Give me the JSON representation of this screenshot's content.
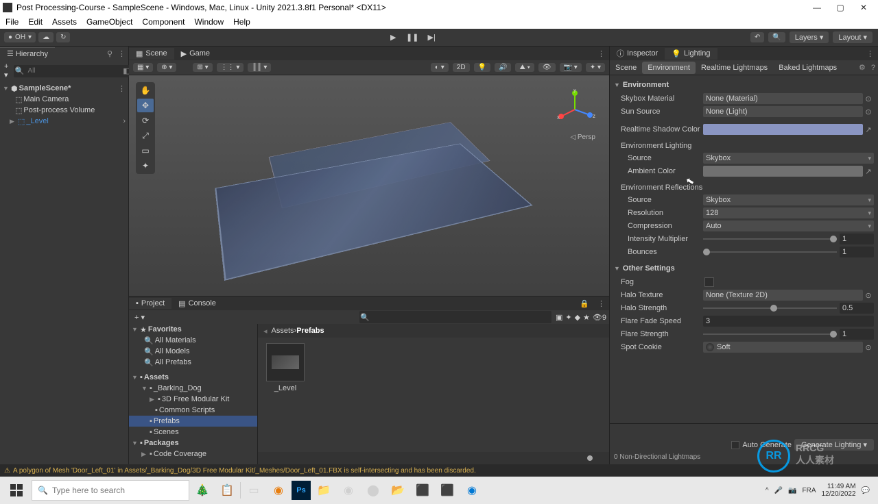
{
  "window": {
    "title": "Post Processing-Course - SampleScene - Windows, Mac, Linux - Unity 2021.3.8f1 Personal* <DX11>",
    "min": "—",
    "max": "▢",
    "close": "✕"
  },
  "menu": [
    "File",
    "Edit",
    "Assets",
    "GameObject",
    "Component",
    "Window",
    "Help"
  ],
  "toolbar": {
    "account": "OH",
    "layers": "Layers",
    "layout": "Layout",
    "play": "▶",
    "pause": "❚❚",
    "step": "▶|"
  },
  "hierarchy": {
    "tab": "Hierarchy",
    "searchPlaceholder": "All",
    "scene": "SampleScene*",
    "items": [
      "Main Camera",
      "Post-process Volume",
      "_Level"
    ]
  },
  "sceneTabs": {
    "scene": "Scene",
    "game": "Game"
  },
  "sceneToolbar": {
    "twoD": "2D",
    "persp": "Persp",
    "axes": {
      "x": "x",
      "y": "y",
      "z": "z"
    }
  },
  "project": {
    "tabs": {
      "project": "Project",
      "console": "Console"
    },
    "crumb": {
      "root": "Assets",
      "sep": "›",
      "leaf": "Prefabs"
    },
    "favorites": "Favorites",
    "favItems": [
      "All Materials",
      "All Models",
      "All Prefabs"
    ],
    "assets": "Assets",
    "folders": [
      "_Barking_Dog",
      "3D Free Modular Kit",
      "Common Scripts",
      "Prefabs",
      "Scenes"
    ],
    "packages": "Packages",
    "pkgItems": [
      "Code Coverage"
    ],
    "assetName": "_Level",
    "layerCount": "9"
  },
  "inspector": {
    "tabs": {
      "inspector": "Inspector",
      "lighting": "Lighting"
    },
    "subtabs": [
      "Scene",
      "Environment",
      "Realtime Lightmaps",
      "Baked Lightmaps"
    ],
    "activeSub": "Environment",
    "env": {
      "header": "Environment",
      "skyboxLabel": "Skybox Material",
      "skyboxVal": "None (Material)",
      "sunLabel": "Sun Source",
      "sunVal": "None (Light)",
      "shadowLabel": "Realtime Shadow Color",
      "shadowColor": "#8a95c2",
      "lightingHeader": "Environment Lighting",
      "sourceLabel": "Source",
      "sourceVal": "Skybox",
      "ambientLabel": "Ambient Color",
      "ambientColor": "#707070",
      "reflectHeader": "Environment Reflections",
      "refSourceLabel": "Source",
      "refSourceVal": "Skybox",
      "resLabel": "Resolution",
      "resVal": "128",
      "compLabel": "Compression",
      "compVal": "Auto",
      "intLabel": "Intensity Multiplier",
      "intVal": "1",
      "bouncesLabel": "Bounces",
      "bouncesVal": "1"
    },
    "other": {
      "header": "Other Settings",
      "fogLabel": "Fog",
      "haloTexLabel": "Halo Texture",
      "haloTexVal": "None (Texture 2D)",
      "haloStrLabel": "Halo Strength",
      "haloStrVal": "0.5",
      "flareFadeLabel": "Flare Fade Speed",
      "flareFadeVal": "3",
      "flareStrLabel": "Flare Strength",
      "flareStrVal": "1",
      "spotLabel": "Spot Cookie",
      "spotVal": "Soft"
    },
    "footer": {
      "auto": "Auto Generate",
      "gen": "Generate Lighting",
      "info": "0 Non-Directional Lightmaps"
    }
  },
  "status": {
    "msg": "A polygon of Mesh 'Door_Left_01' in Assets/_Barking_Dog/3D Free Modular Kit/_Meshes/Door_Left_01.FBX is self-intersecting and has been discarded."
  },
  "taskbar": {
    "search": "Type here to search",
    "lang": "FRA",
    "time": "11:49 AM",
    "date": "12/20/2022"
  },
  "watermark": {
    "rr": "RR",
    "txt1": "RRCG",
    "txt2": "人人素材"
  }
}
